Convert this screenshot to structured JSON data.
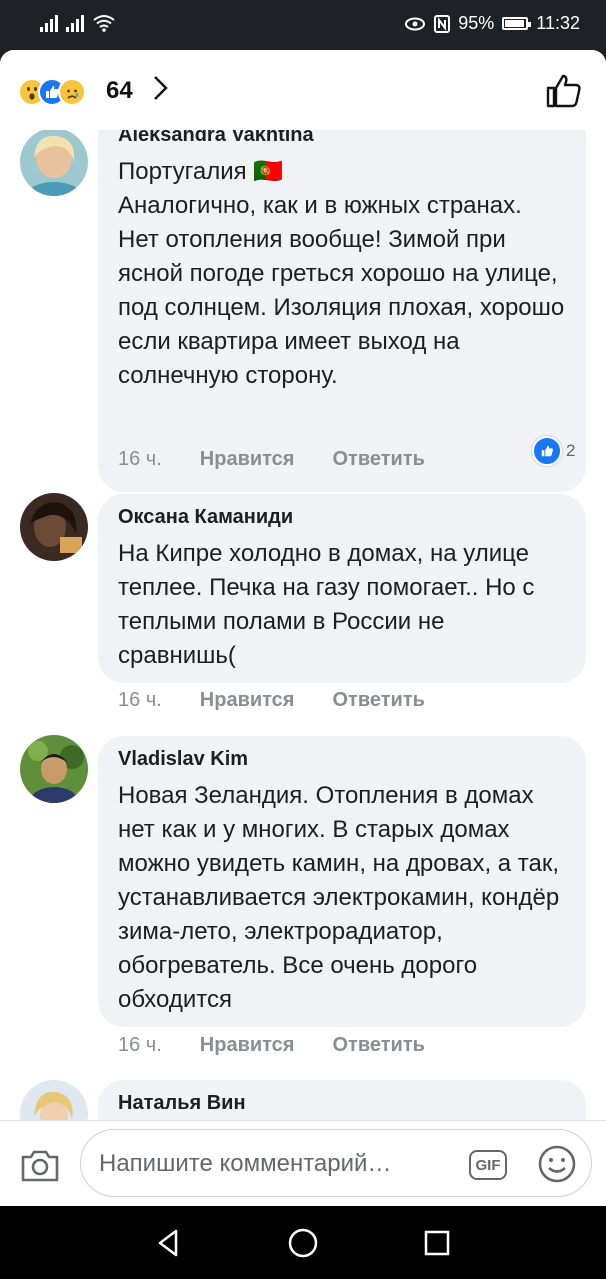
{
  "status_bar": {
    "battery": "95%",
    "time": "11:32"
  },
  "header": {
    "reaction_count": "64",
    "reactions": [
      "wow",
      "like",
      "sad"
    ]
  },
  "comments": [
    {
      "author": "Aleksandra Vakhtina",
      "text": "Португалия 🇵🇹\nАналогично, как и в южных странах. Нет отопления вообще! Зимой при ясной погоде греться хорошо на улице, под солнцем. Изоляция плохая, хорошо если квартира имеет выход на солнечную сторону.",
      "time": "16 ч.",
      "like": "Нравится",
      "reply": "Ответить",
      "reactions": "2"
    },
    {
      "author": "Оксана Каманиди",
      "text": "На Кипре холодно в домах, на улице теплее. Печка на газу помогает.. Но с теплыми полами в России не сравнишь(",
      "time": "16 ч.",
      "like": "Нравится",
      "reply": "Ответить"
    },
    {
      "author": "Vladislav Kim",
      "text": "Новая Зеландия. Отопления в домах нет как и у многих. В старых домах можно увидеть камин, на дровах, а  так, устанавливается электрокамин, кондёр зима-лето, электрорадиатор, обогреватель. Все очень дорого обходится",
      "time": "16 ч.",
      "like": "Нравится",
      "reply": "Ответить"
    },
    {
      "author": "Наталья Вин"
    }
  ],
  "composer": {
    "placeholder": "Напишите комментарий…",
    "gif_label": "GIF"
  },
  "colors": {
    "accent": "#1877f2",
    "bubble": "#f0f2f5",
    "meta": "#8a8d91"
  }
}
